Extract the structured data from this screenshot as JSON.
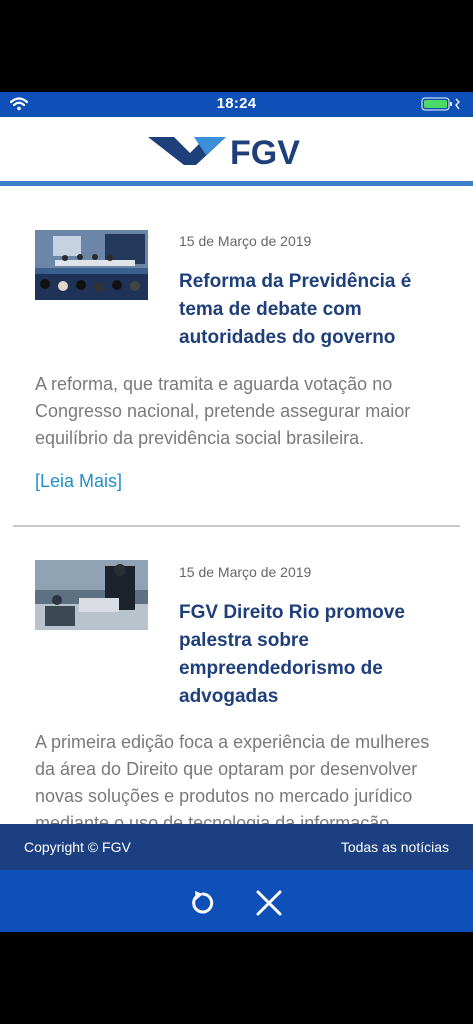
{
  "status_bar": {
    "time": "18:24",
    "wifi_icon": "wifi-icon",
    "battery_icon": "battery-icon"
  },
  "header": {
    "logo_text": "FGV"
  },
  "articles": [
    {
      "date": "15 de Março de 2019",
      "title": "Reforma da Previdência é tema de debate com autoridades do governo",
      "excerpt": "A reforma, que tramita e aguarda votação no Congresso nacional, pretende assegurar maior equilíbrio da previdência social brasileira.",
      "read_more": "[Leia Mais]"
    },
    {
      "date": "15 de Março de 2019",
      "title": "FGV Direito Rio promove palestra sobre empreendedorismo de advogadas",
      "excerpt": "A primeira edição foca a experiência de mulheres da área do Direito que optaram por desenvolver novas soluções e produtos no mercado jurídico mediante o uso de tecnologia da informação"
    }
  ],
  "footer": {
    "copyright": "Copyright © FGV",
    "all_news": "Todas as notícias"
  },
  "toolbar": {
    "reload_icon": "reload-icon",
    "close_icon": "close-icon"
  },
  "colors": {
    "brand_blue": "#0e4fb8",
    "footer_navy": "#1b3f80",
    "title_navy": "#1e3f7a",
    "link": "#1f8fc9"
  }
}
